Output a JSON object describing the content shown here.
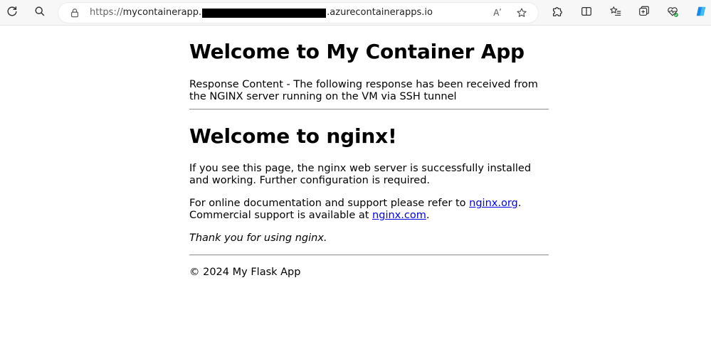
{
  "browser": {
    "url_scheme": "https://",
    "url_host_start": "mycontainerapp.",
    "url_host_end": ".azurecontainerapps.io",
    "read_aloud_label": "Aʹ"
  },
  "page": {
    "title": "Welcome to My Container App",
    "response_text": "Response Content - The following response has been received from the NGINX server running on the VM via SSH tunnel",
    "nginx_heading": "Welcome to nginx!",
    "nginx_p1": "If you see this page, the nginx web server is successfully installed and working. Further configuration is required.",
    "nginx_p2_prefix": "For online documentation and support please refer to ",
    "nginx_org_link": "nginx.org",
    "nginx_p2_mid": ".",
    "nginx_p2_prefix2": "Commercial support is available at ",
    "nginx_com_link": "nginx.com",
    "nginx_p2_suffix": ".",
    "nginx_thanks": "Thank you for using nginx.",
    "footer": "© 2024 My Flask App"
  },
  "colors": {
    "link": "#0000ee",
    "toolbar_bg": "#f7f7f7"
  }
}
